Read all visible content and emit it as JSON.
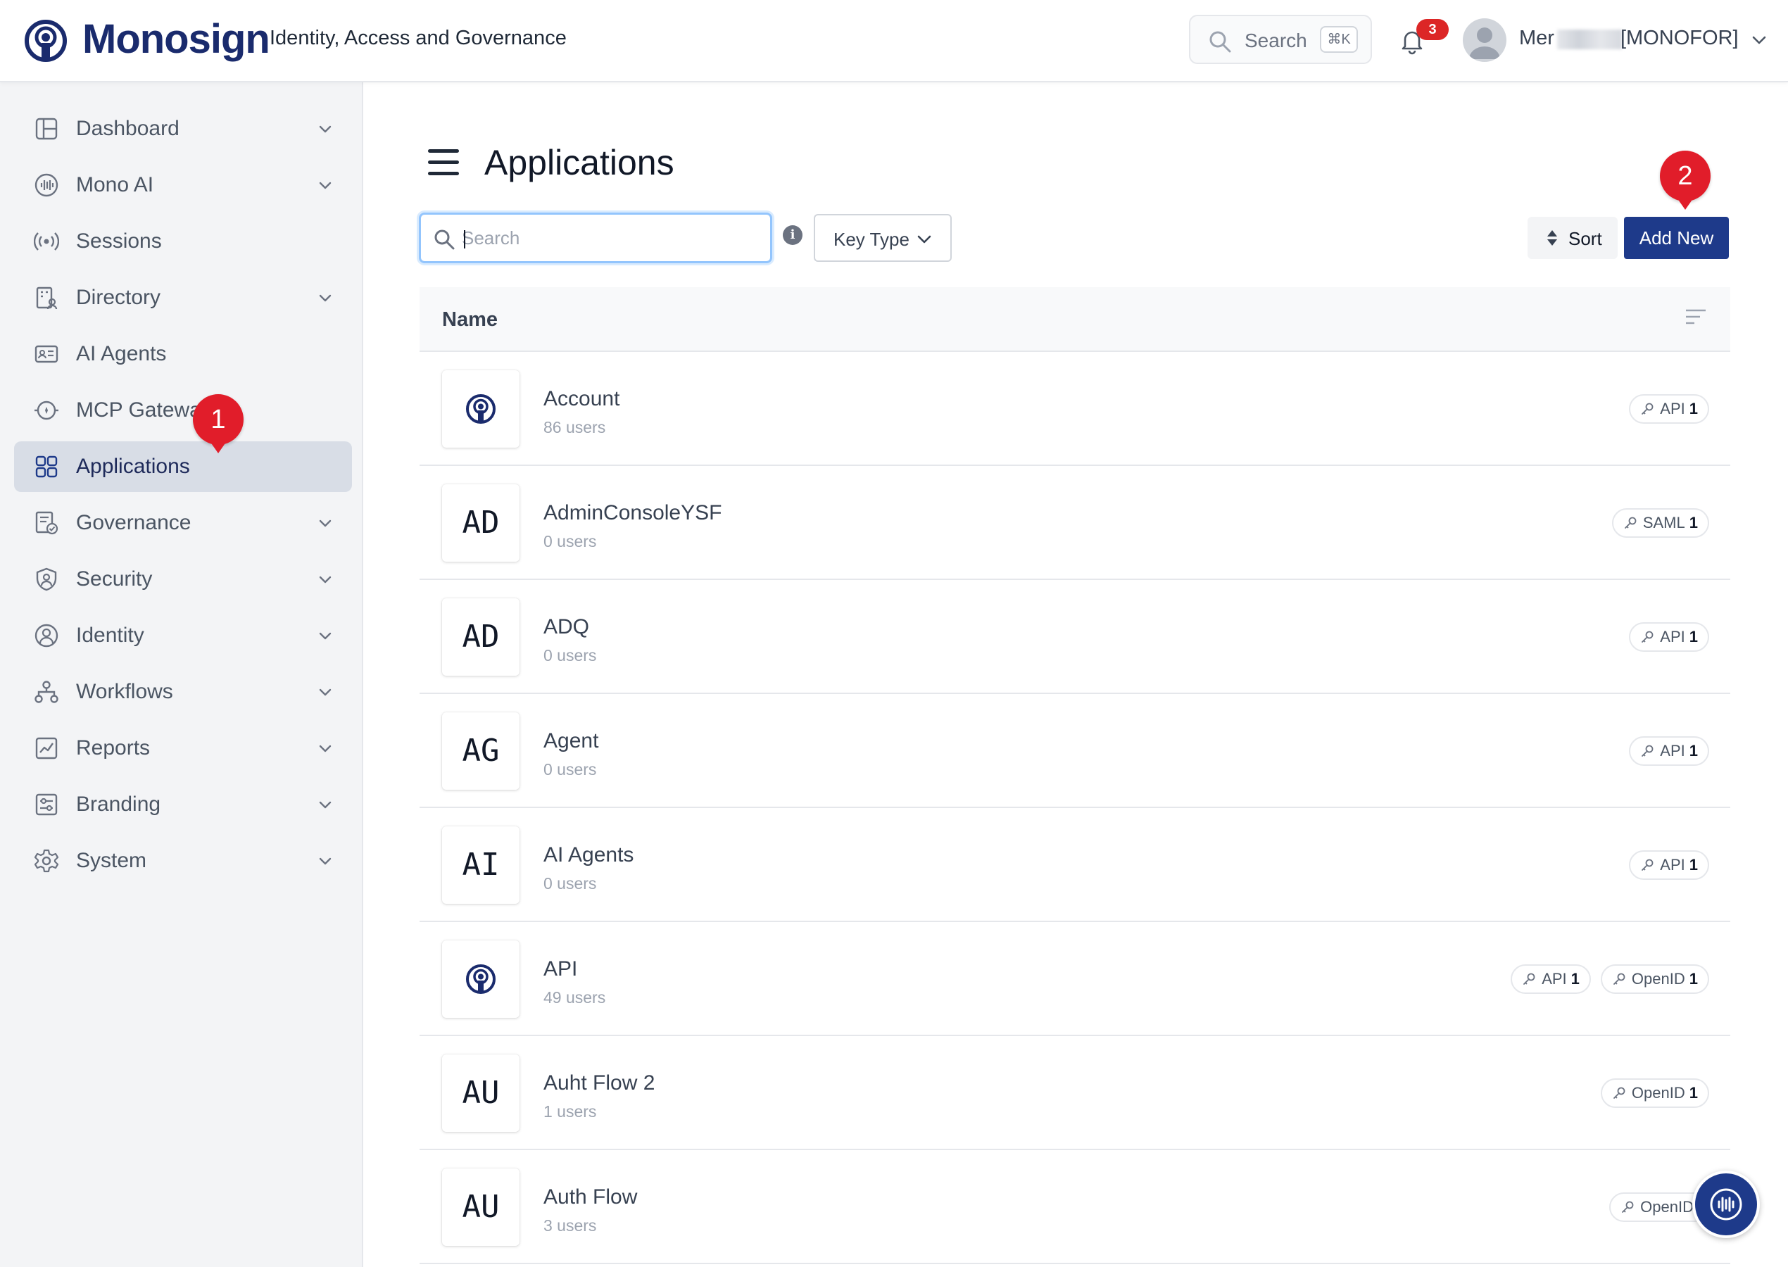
{
  "header": {
    "brand": "Monosign",
    "tagline": "Identity, Access and Governance",
    "search_label": "Search",
    "search_shortcut": "⌘K",
    "notification_count": "3",
    "user_prefix": "Mer",
    "user_org": "[MONOFOR]"
  },
  "sidebar": {
    "items": [
      {
        "label": "Dashboard",
        "icon": "dashboard-icon",
        "has_chevron": true
      },
      {
        "label": "Mono AI",
        "icon": "ai-wave-icon",
        "has_chevron": true
      },
      {
        "label": "Sessions",
        "icon": "broadcast-icon",
        "has_chevron": false
      },
      {
        "label": "Directory",
        "icon": "directory-icon",
        "has_chevron": true
      },
      {
        "label": "AI Agents",
        "icon": "agent-card-icon",
        "has_chevron": false
      },
      {
        "label": "MCP Gateway",
        "icon": "gateway-icon",
        "has_chevron": false
      },
      {
        "label": "Applications",
        "icon": "apps-grid-icon",
        "has_chevron": false,
        "active": true
      },
      {
        "label": "Governance",
        "icon": "governance-icon",
        "has_chevron": true
      },
      {
        "label": "Security",
        "icon": "shield-icon",
        "has_chevron": true
      },
      {
        "label": "Identity",
        "icon": "user-circle-icon",
        "has_chevron": true
      },
      {
        "label": "Workflows",
        "icon": "workflow-icon",
        "has_chevron": true
      },
      {
        "label": "Reports",
        "icon": "chart-icon",
        "has_chevron": true
      },
      {
        "label": "Branding",
        "icon": "sliders-icon",
        "has_chevron": true
      },
      {
        "label": "System",
        "icon": "gear-icon",
        "has_chevron": true
      }
    ]
  },
  "markers": {
    "first": "1",
    "second": "2"
  },
  "main": {
    "title": "Applications",
    "search_placeholder": "Search",
    "info_glyph": "i",
    "key_type_label": "Key Type",
    "sort_label": "Sort",
    "add_new_label": "Add New",
    "column_name": "Name",
    "applications": [
      {
        "name": "Account",
        "users": "86 users",
        "thumb": "logo",
        "tags": [
          {
            "type": "API",
            "count": "1"
          }
        ]
      },
      {
        "name": "AdminConsoleYSF",
        "users": "0 users",
        "thumb": "AD",
        "tags": [
          {
            "type": "SAML",
            "count": "1"
          }
        ]
      },
      {
        "name": "ADQ",
        "users": "0 users",
        "thumb": "AD",
        "tags": [
          {
            "type": "API",
            "count": "1"
          }
        ]
      },
      {
        "name": "Agent",
        "users": "0 users",
        "thumb": "AG",
        "tags": [
          {
            "type": "API",
            "count": "1"
          }
        ]
      },
      {
        "name": "AI Agents",
        "users": "0 users",
        "thumb": "AI",
        "tags": [
          {
            "type": "API",
            "count": "1"
          }
        ]
      },
      {
        "name": "API",
        "users": "49 users",
        "thumb": "logo",
        "tags": [
          {
            "type": "API",
            "count": "1"
          },
          {
            "type": "OpenID",
            "count": "1"
          }
        ]
      },
      {
        "name": "Auht Flow 2",
        "users": "1 users",
        "thumb": "AU",
        "tags": [
          {
            "type": "OpenID",
            "count": "1"
          }
        ]
      },
      {
        "name": "Auth Flow",
        "users": "3 users",
        "thumb": "AU",
        "tags": [
          {
            "type": "OpenID",
            "count": ""
          }
        ]
      }
    ]
  },
  "colors": {
    "brand": "#1a2b6d",
    "primary_button": "#1e3a8a",
    "marker": "#e11d2a",
    "badge": "#dc2626"
  }
}
